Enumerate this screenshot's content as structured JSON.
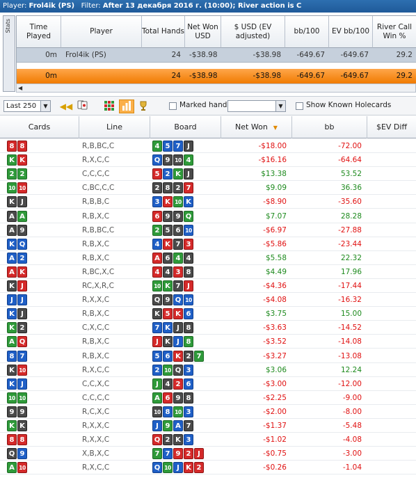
{
  "titlebar": {
    "player_label": "Player:",
    "player_name": "Frol4ik (PS)",
    "filter_label": "Filter:",
    "filter_value": "After 13 декабря 2016 г. (10:00); River action is C"
  },
  "stats": {
    "tab_label": "Stats",
    "headers": [
      "Time Played",
      "Player",
      "Total Hands",
      "Net Won USD",
      "$ USD (EV adjusted)",
      "bb/100",
      "EV bb/100",
      "River Call Win %"
    ],
    "row": {
      "time": "0m",
      "player": "Frol4ik (PS)",
      "hands": "24",
      "net": "-$38.98",
      "ev_usd": "-$38.98",
      "bb100": "-649.67",
      "ev_bb100": "-649.67",
      "rcw": "29.2"
    },
    "total": {
      "time": "0m",
      "hands": "24",
      "net": "-$38.98",
      "ev_usd": "-$38.98",
      "bb100": "-649.67",
      "ev_bb100": "-649.67",
      "rcw": "29.2"
    }
  },
  "toolbar": {
    "range_select": "Last 250",
    "marked_hands_label": "Marked hands",
    "show_known_label": "Show Known Holecards"
  },
  "table": {
    "headers": {
      "cards": "Cards",
      "line": "Line",
      "board": "Board",
      "net": "Net Won",
      "bb": "bb",
      "ev": "$EV Diff"
    },
    "rows": [
      {
        "cards": [
          [
            "8",
            "h"
          ],
          [
            "8",
            "h"
          ]
        ],
        "line": "R,B,BC,C",
        "board": [
          [
            "4",
            "c"
          ],
          [
            "5",
            "d"
          ],
          [
            "7",
            "d"
          ],
          [
            "J",
            "s"
          ]
        ],
        "net": "-$18.00",
        "bb": "-72.00",
        "sign": "neg"
      },
      {
        "cards": [
          [
            "K",
            "c"
          ],
          [
            "K",
            "h"
          ]
        ],
        "line": "R,X,C,C",
        "board": [
          [
            "Q",
            "d"
          ],
          [
            "9",
            "s"
          ],
          [
            "10",
            "s"
          ],
          [
            "4",
            "c"
          ]
        ],
        "net": "-$16.16",
        "bb": "-64.64",
        "sign": "neg"
      },
      {
        "cards": [
          [
            "2",
            "c"
          ],
          [
            "2",
            "c"
          ]
        ],
        "line": "C,C,C,C",
        "board": [
          [
            "5",
            "h"
          ],
          [
            "2",
            "d"
          ],
          [
            "K",
            "c"
          ],
          [
            "J",
            "s"
          ]
        ],
        "net": "$13.38",
        "bb": "53.52",
        "sign": "pos"
      },
      {
        "cards": [
          [
            "10",
            "c"
          ],
          [
            "10",
            "h"
          ]
        ],
        "line": "C,BC,C,C",
        "board": [
          [
            "2",
            "s"
          ],
          [
            "8",
            "s"
          ],
          [
            "2",
            "s"
          ],
          [
            "7",
            "h"
          ]
        ],
        "net": "$9.09",
        "bb": "36.36",
        "sign": "pos"
      },
      {
        "cards": [
          [
            "K",
            "s"
          ],
          [
            "J",
            "s"
          ]
        ],
        "line": "R,B,B,C",
        "board": [
          [
            "3",
            "d"
          ],
          [
            "K",
            "h"
          ],
          [
            "10",
            "c"
          ],
          [
            "K",
            "d"
          ]
        ],
        "net": "-$8.90",
        "bb": "-35.60",
        "sign": "neg"
      },
      {
        "cards": [
          [
            "A",
            "s"
          ],
          [
            "A",
            "c"
          ]
        ],
        "line": "R,B,X,C",
        "board": [
          [
            "6",
            "h"
          ],
          [
            "9",
            "s"
          ],
          [
            "9",
            "s"
          ],
          [
            "Q",
            "c"
          ]
        ],
        "net": "$7.07",
        "bb": "28.28",
        "sign": "pos"
      },
      {
        "cards": [
          [
            "A",
            "s"
          ],
          [
            "9",
            "s"
          ]
        ],
        "line": "R,B,BC,C",
        "board": [
          [
            "2",
            "c"
          ],
          [
            "5",
            "s"
          ],
          [
            "6",
            "s"
          ],
          [
            "10",
            "d"
          ]
        ],
        "net": "-$6.97",
        "bb": "-27.88",
        "sign": "neg"
      },
      {
        "cards": [
          [
            "K",
            "d"
          ],
          [
            "Q",
            "d"
          ]
        ],
        "line": "R,B,X,C",
        "board": [
          [
            "4",
            "d"
          ],
          [
            "K",
            "h"
          ],
          [
            "7",
            "s"
          ],
          [
            "3",
            "h"
          ]
        ],
        "net": "-$5.86",
        "bb": "-23.44",
        "sign": "neg"
      },
      {
        "cards": [
          [
            "A",
            "d"
          ],
          [
            "2",
            "d"
          ]
        ],
        "line": "R,B,X,C",
        "board": [
          [
            "A",
            "h"
          ],
          [
            "6",
            "s"
          ],
          [
            "4",
            "c"
          ],
          [
            "4",
            "s"
          ]
        ],
        "net": "$5.58",
        "bb": "22.32",
        "sign": "pos"
      },
      {
        "cards": [
          [
            "A",
            "h"
          ],
          [
            "K",
            "h"
          ]
        ],
        "line": "R,BC,X,C",
        "board": [
          [
            "4",
            "h"
          ],
          [
            "4",
            "s"
          ],
          [
            "3",
            "h"
          ],
          [
            "8",
            "s"
          ]
        ],
        "net": "$4.49",
        "bb": "17.96",
        "sign": "pos"
      },
      {
        "cards": [
          [
            "K",
            "s"
          ],
          [
            "J",
            "h"
          ]
        ],
        "line": "RC,X,R,C",
        "board": [
          [
            "10",
            "c"
          ],
          [
            "K",
            "c"
          ],
          [
            "7",
            "s"
          ],
          [
            "J",
            "h"
          ]
        ],
        "net": "-$4.36",
        "bb": "-17.44",
        "sign": "neg"
      },
      {
        "cards": [
          [
            "J",
            "d"
          ],
          [
            "J",
            "d"
          ]
        ],
        "line": "R,X,X,C",
        "board": [
          [
            "Q",
            "s"
          ],
          [
            "9",
            "s"
          ],
          [
            "Q",
            "d"
          ],
          [
            "10",
            "d"
          ]
        ],
        "net": "-$4.08",
        "bb": "-16.32",
        "sign": "neg"
      },
      {
        "cards": [
          [
            "K",
            "d"
          ],
          [
            "J",
            "s"
          ]
        ],
        "line": "R,B,X,C",
        "board": [
          [
            "K",
            "s"
          ],
          [
            "5",
            "h"
          ],
          [
            "K",
            "h"
          ],
          [
            "6",
            "d"
          ]
        ],
        "net": "$3.75",
        "bb": "15.00",
        "sign": "pos"
      },
      {
        "cards": [
          [
            "K",
            "c"
          ],
          [
            "2",
            "s"
          ]
        ],
        "line": "C,X,C,C",
        "board": [
          [
            "7",
            "d"
          ],
          [
            "K",
            "d"
          ],
          [
            "J",
            "s"
          ],
          [
            "8",
            "s"
          ]
        ],
        "net": "-$3.63",
        "bb": "-14.52",
        "sign": "neg"
      },
      {
        "cards": [
          [
            "A",
            "c"
          ],
          [
            "Q",
            "h"
          ]
        ],
        "line": "R,B,X,C",
        "board": [
          [
            "J",
            "h"
          ],
          [
            "K",
            "s"
          ],
          [
            "J",
            "d"
          ],
          [
            "8",
            "c"
          ]
        ],
        "net": "-$3.52",
        "bb": "-14.08",
        "sign": "neg"
      },
      {
        "cards": [
          [
            "8",
            "d"
          ],
          [
            "7",
            "d"
          ]
        ],
        "line": "R,B,X,C",
        "board": [
          [
            "5",
            "d"
          ],
          [
            "6",
            "d"
          ],
          [
            "K",
            "h"
          ],
          [
            "2",
            "s"
          ],
          [
            "7",
            "c"
          ]
        ],
        "net": "-$3.27",
        "bb": "-13.08",
        "sign": "neg"
      },
      {
        "cards": [
          [
            "K",
            "s"
          ],
          [
            "10",
            "h"
          ]
        ],
        "line": "R,X,C,C",
        "board": [
          [
            "2",
            "d"
          ],
          [
            "10",
            "c"
          ],
          [
            "Q",
            "s"
          ],
          [
            "3",
            "d"
          ]
        ],
        "net": "$3.06",
        "bb": "12.24",
        "sign": "pos"
      },
      {
        "cards": [
          [
            "K",
            "d"
          ],
          [
            "J",
            "d"
          ]
        ],
        "line": "C,C,X,C",
        "board": [
          [
            "J",
            "c"
          ],
          [
            "4",
            "s"
          ],
          [
            "2",
            "h"
          ],
          [
            "6",
            "d"
          ]
        ],
        "net": "-$3.00",
        "bb": "-12.00",
        "sign": "neg"
      },
      {
        "cards": [
          [
            "10",
            "c"
          ],
          [
            "10",
            "c"
          ]
        ],
        "line": "C,C,C,C",
        "board": [
          [
            "A",
            "c"
          ],
          [
            "6",
            "h"
          ],
          [
            "9",
            "s"
          ],
          [
            "8",
            "s"
          ]
        ],
        "net": "-$2.25",
        "bb": "-9.00",
        "sign": "neg"
      },
      {
        "cards": [
          [
            "9",
            "s"
          ],
          [
            "9",
            "s"
          ]
        ],
        "line": "R,C,X,C",
        "board": [
          [
            "10",
            "s"
          ],
          [
            "8",
            "d"
          ],
          [
            "10",
            "c"
          ],
          [
            "3",
            "d"
          ]
        ],
        "net": "-$2.00",
        "bb": "-8.00",
        "sign": "neg"
      },
      {
        "cards": [
          [
            "K",
            "c"
          ],
          [
            "K",
            "s"
          ]
        ],
        "line": "R,X,X,C",
        "board": [
          [
            "J",
            "d"
          ],
          [
            "9",
            "c"
          ],
          [
            "A",
            "d"
          ],
          [
            "7",
            "s"
          ]
        ],
        "net": "-$1.37",
        "bb": "-5.48",
        "sign": "neg"
      },
      {
        "cards": [
          [
            "8",
            "h"
          ],
          [
            "8",
            "h"
          ]
        ],
        "line": "R,X,X,C",
        "board": [
          [
            "Q",
            "h"
          ],
          [
            "2",
            "s"
          ],
          [
            "K",
            "s"
          ],
          [
            "3",
            "d"
          ]
        ],
        "net": "-$1.02",
        "bb": "-4.08",
        "sign": "neg"
      },
      {
        "cards": [
          [
            "Q",
            "s"
          ],
          [
            "9",
            "d"
          ]
        ],
        "line": "X,B,X,C",
        "board": [
          [
            "7",
            "c"
          ],
          [
            "7",
            "d"
          ],
          [
            "9",
            "h"
          ],
          [
            "2",
            "h"
          ],
          [
            "J",
            "h"
          ]
        ],
        "net": "-$0.75",
        "bb": "-3.00",
        "sign": "neg"
      },
      {
        "cards": [
          [
            "A",
            "c"
          ],
          [
            "10",
            "h"
          ]
        ],
        "line": "R,X,C,C",
        "board": [
          [
            "Q",
            "d"
          ],
          [
            "10",
            "c"
          ],
          [
            "J",
            "d"
          ],
          [
            "K",
            "h"
          ],
          [
            "2",
            "h"
          ]
        ],
        "net": "-$0.26",
        "bb": "-1.04",
        "sign": "neg"
      }
    ]
  }
}
